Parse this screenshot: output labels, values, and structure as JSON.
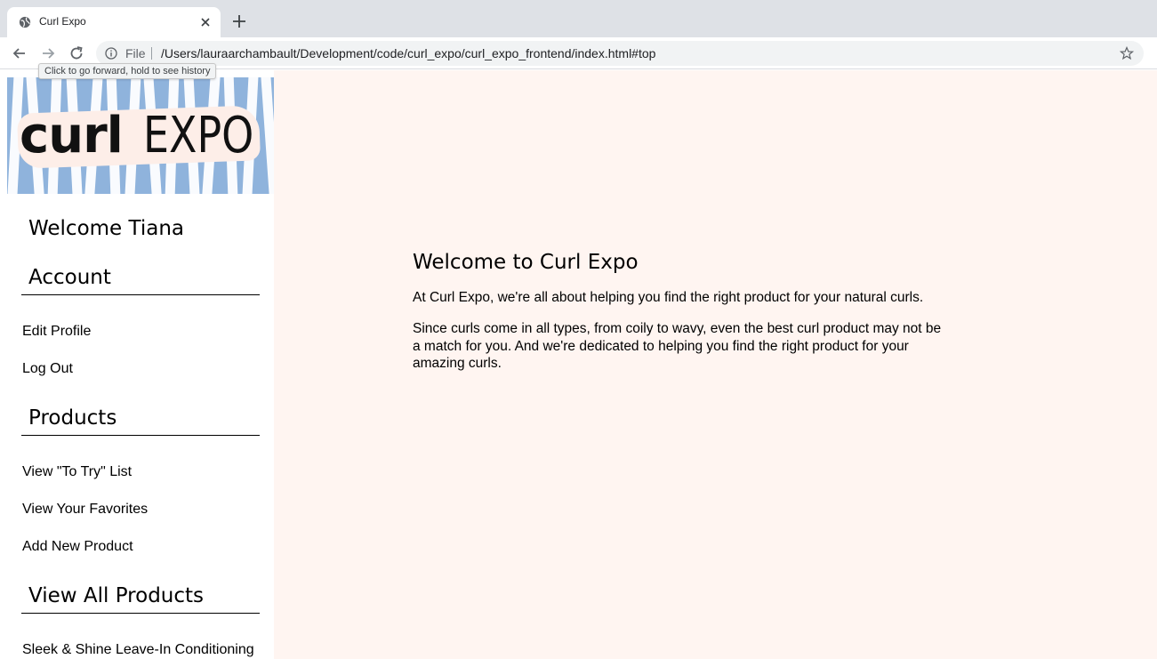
{
  "browser": {
    "tab_title": "Curl Expo",
    "omnibox_scheme_label": "File",
    "url": "/Users/lauraarchambault/Development/code/curl_expo/curl_expo_frontend/index.html#top",
    "tooltip": "Click to go forward, hold to see history",
    "icons": [
      "globe-icon",
      "close-icon",
      "plus-icon",
      "back-arrow-icon",
      "forward-arrow-icon",
      "reload-icon",
      "info-icon",
      "star-icon"
    ]
  },
  "sidebar": {
    "welcome": "Welcome Tiana",
    "sections": {
      "account": {
        "heading": "Account",
        "links": [
          "Edit Profile",
          "Log Out"
        ]
      },
      "products": {
        "heading": "Products",
        "links": [
          "View \"To Try\" List",
          "View Your Favorites",
          "Add New Product"
        ]
      },
      "all_products": {
        "heading": "View All Products",
        "links": [
          "Sleek & Shine Leave-In Conditioning"
        ]
      }
    }
  },
  "logo": {
    "text_bold": "curl",
    "text_light": "EXPO",
    "colors": {
      "stripe_bg": "#8fb3dc",
      "blob": "#fdeee8"
    }
  },
  "main": {
    "title": "Welcome to Curl Expo",
    "paragraphs": [
      "At Curl Expo, we're all about helping you find the right product for your natural curls.",
      "Since curls come in all types, from coily to wavy, even the best curl product may not be a match for you. And we're dedicated to helping you find the right product for your amazing curls."
    ],
    "background_color": "#fff5f1"
  }
}
